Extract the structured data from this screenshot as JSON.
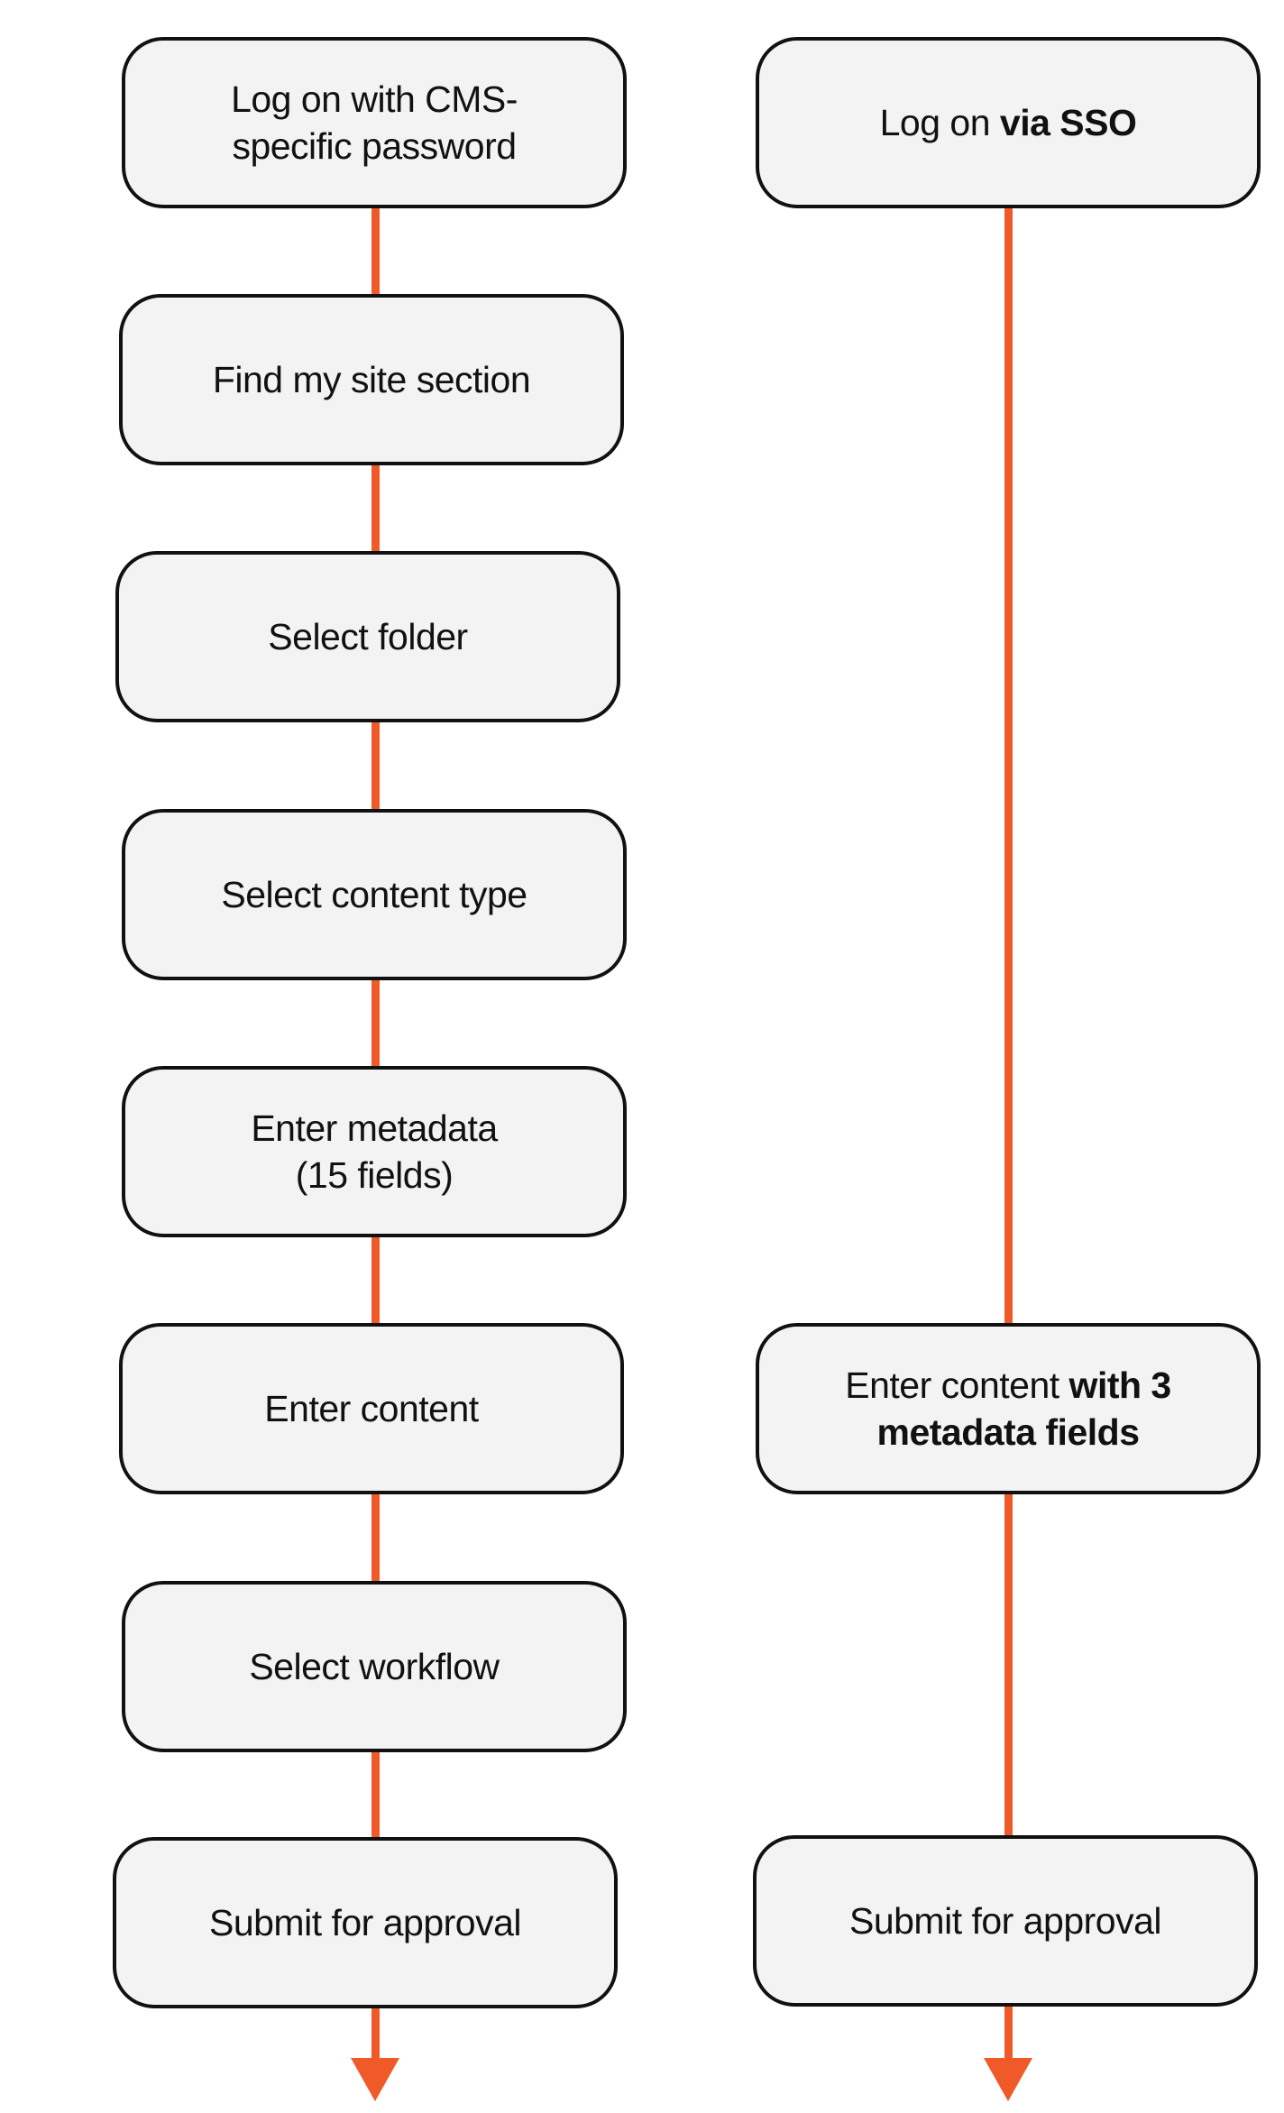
{
  "colors": {
    "connector": "#f05a28",
    "box_fill": "#f3f3f3",
    "box_border": "#111111"
  },
  "left_flow": [
    {
      "label": "Log on with CMS-specific password"
    },
    {
      "label": "Find my site section"
    },
    {
      "label": "Select folder"
    },
    {
      "label": "Select content type"
    },
    {
      "label": "Enter metadata (15 fields)"
    },
    {
      "label": "Enter content"
    },
    {
      "label": "Select workflow"
    },
    {
      "label": "Submit for approval"
    }
  ],
  "right_flow": [
    {
      "label_plain": "Log on ",
      "label_bold": "via SSO"
    },
    {
      "label_plain": "Enter content ",
      "label_bold": "with 3 metadata fields"
    },
    {
      "label": "Submit for approval"
    }
  ]
}
